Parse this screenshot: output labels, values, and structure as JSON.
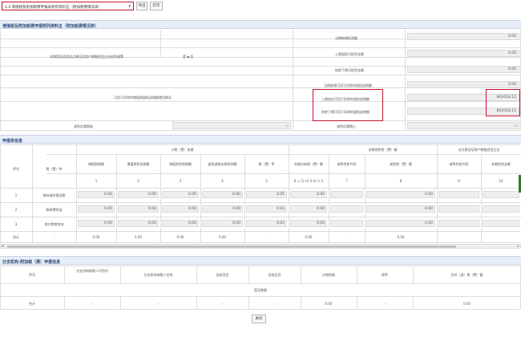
{
  "toolbar": {
    "report_select_value": "2.4 增值税及附加税费申报表附列资料五（附加税费情况表）",
    "export_label": "导出",
    "print_label": "打印"
  },
  "section1": {
    "title": "增值税及附加税费申报附列资料五（附加税费情况表）",
    "enterprise_question": "本期是否适用试点建设培育产教融合型企业抵免政策",
    "yes_no": "是 ▪ 否",
    "deduction_situation": "可用于扣除的增值税留抵退税额使用情况",
    "rows": [
      {
        "label": "当期新增投资额",
        "value": "0.00"
      },
      {
        "label": "上期留抵可抵免金额",
        "value": "0.00"
      },
      {
        "label": "结转下期可抵免金额",
        "value": "0.00"
      },
      {
        "label": "当期新增可用于扣除的留抵退税额",
        "value": "0.00"
      },
      {
        "label": "上期结存可用于扣除的留抵退税额",
        "value": "802018.12"
      },
      {
        "label": "结转下期可用于扣除的留抵退税额",
        "value": "802018.12"
      }
    ],
    "period_start_label": "减免优惠期起",
    "period_end_label": "减免优惠期止"
  },
  "section2": {
    "title": "申报表信息",
    "col_seq": "序号",
    "col_tax": "税（费）种",
    "group_basis": "计税（费）依据",
    "group_reduction": "本期减免税（费）额",
    "group_pilot": "试点建设培育产教融合型企业",
    "sub_headers": [
      "增值税税额",
      "增值税免抵税额",
      "增值税免税税额",
      "留抵退税本期扣除额",
      "税（费）率",
      "本期应纳税（费）额",
      "减免性质代码",
      "减免税（费）额",
      "减免性质代码",
      "本期抵免金额"
    ],
    "formula_row": [
      "1",
      "2",
      "3",
      "4",
      "5",
      "6 = (1+2-3-4) × 5",
      "7",
      "8",
      "9",
      "10"
    ],
    "rows": [
      {
        "seq": "1",
        "name": "城市维护建设税",
        "v1": "0.00",
        "v2": "0.00",
        "v3": "0.00",
        "v4": "0.00",
        "rate": "0.05",
        "v6": "0.00",
        "v8": "0.00"
      },
      {
        "seq": "2",
        "name": "教育费附加",
        "v1": "0.00",
        "v2": "0.00",
        "v3": "0.00",
        "v4": "0.00",
        "rate": "0.03",
        "v6": "0.00",
        "v8": "0.00"
      },
      {
        "seq": "3",
        "name": "地方教育附加",
        "v1": "0.00",
        "v2": "0.00",
        "v3": "0.00",
        "v4": "0.00",
        "rate": "0.02",
        "v6": "0.00",
        "v8": "0.00"
      }
    ],
    "total": {
      "label": "合计",
      "dash": "-",
      "v1": "0.00",
      "v2": "0.00",
      "v3": "0.00",
      "v4": "0.00",
      "v6": "0.00",
      "v8": "0.00"
    }
  },
  "section3": {
    "title": "分支机构-附加税（费）申报信息",
    "headers": [
      "序号",
      "分支机构纳税人识别号",
      "分支机构纳税人名称",
      "征收项目",
      "征收品目",
      "计税依据",
      "税率",
      "应补（退）税（费）额"
    ],
    "empty_text": "暂无数据",
    "total_label": "合计",
    "dash": "-",
    "total_base": "0.00",
    "total_amount": "0.00"
  },
  "footer": {
    "close_label": "关闭"
  }
}
